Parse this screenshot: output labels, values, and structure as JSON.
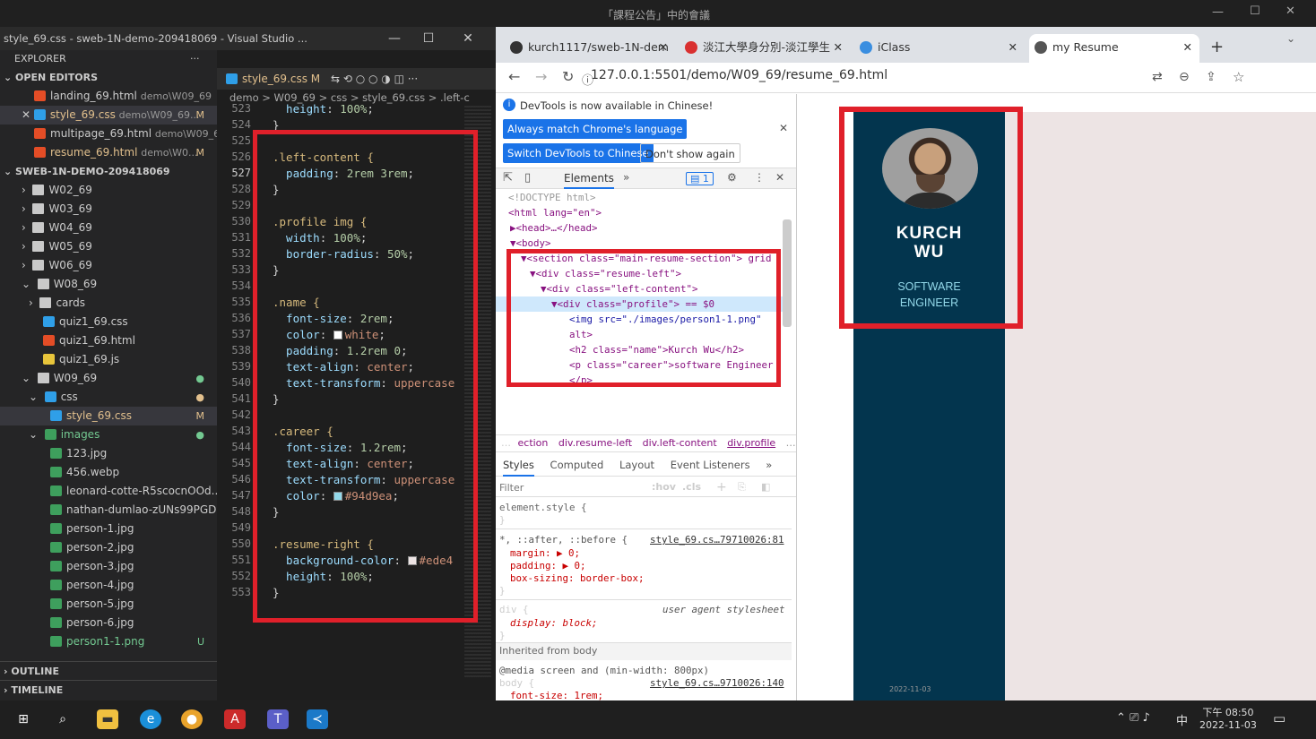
{
  "topbar": {
    "title": "「課程公告」中的會議"
  },
  "vscode": {
    "window_title": "style_69.css - sweb-1N-demo-209418069 - Visual Studio ...",
    "explorer_header": "EXPLORER",
    "open_editors_header": "OPEN EDITORS",
    "open_editors": [
      {
        "name": "landing_69.html",
        "path": "demo\\W09_69",
        "status": ""
      },
      {
        "name": "style_69.css",
        "path": "demo\\W09_69...",
        "status": "M"
      },
      {
        "name": "multipage_69.html",
        "path": "demo\\W09_69",
        "status": ""
      },
      {
        "name": "resume_69.html",
        "path": "demo\\W0...",
        "status": "M"
      }
    ],
    "workspace_header": "SWEB-1N-DEMO-209418069",
    "tree": [
      {
        "name": "W02_69"
      },
      {
        "name": "W03_69"
      },
      {
        "name": "W04_69"
      },
      {
        "name": "W05_69"
      },
      {
        "name": "W06_69"
      },
      {
        "name": "W08_69"
      },
      {
        "name": "cards"
      },
      {
        "name": "quiz1_69.css"
      },
      {
        "name": "quiz1_69.html"
      },
      {
        "name": "quiz1_69.js"
      },
      {
        "name": "W09_69"
      },
      {
        "name": "css"
      },
      {
        "name": "style_69.css",
        "status": "M"
      },
      {
        "name": "images"
      },
      {
        "name": "123.jpg"
      },
      {
        "name": "456.webp"
      },
      {
        "name": "leonard-cotte-R5scocnOOd..."
      },
      {
        "name": "nathan-dumlao-zUNs99PGD..."
      },
      {
        "name": "person-1.jpg"
      },
      {
        "name": "person-2.jpg"
      },
      {
        "name": "person-3.jpg"
      },
      {
        "name": "person-4.jpg"
      },
      {
        "name": "person-5.jpg"
      },
      {
        "name": "person-6.jpg"
      },
      {
        "name": "person1-1.png",
        "status": "U"
      }
    ],
    "outline": "OUTLINE",
    "timeline": "TIMELINE",
    "tab_label": "style_69.css M",
    "breadcrumb": "demo > W09_69 > css > style_69.css > .left-c",
    "code_lines": [
      {
        "n": "523",
        "t": "  height: 100%;"
      },
      {
        "n": "524",
        "t": "}"
      },
      {
        "n": "525",
        "t": ""
      },
      {
        "n": "526",
        "t": ".left-content {"
      },
      {
        "n": "527",
        "t": "  padding: 2rem 3rem;"
      },
      {
        "n": "528",
        "t": "}"
      },
      {
        "n": "529",
        "t": ""
      },
      {
        "n": "530",
        "t": ".profile img {"
      },
      {
        "n": "531",
        "t": "  width: 100%;"
      },
      {
        "n": "532",
        "t": "  border-radius: 50%;"
      },
      {
        "n": "533",
        "t": "}"
      },
      {
        "n": "534",
        "t": ""
      },
      {
        "n": "535",
        "t": ".name {"
      },
      {
        "n": "536",
        "t": "  font-size: 2rem;"
      },
      {
        "n": "537",
        "t": "  color: white;"
      },
      {
        "n": "538",
        "t": "  padding: 1.2rem 0;"
      },
      {
        "n": "539",
        "t": "  text-align: center;"
      },
      {
        "n": "540",
        "t": "  text-transform: uppercase"
      },
      {
        "n": "541",
        "t": "}"
      },
      {
        "n": "542",
        "t": ""
      },
      {
        "n": "543",
        "t": ".career {"
      },
      {
        "n": "544",
        "t": "  font-size: 1.2rem;"
      },
      {
        "n": "545",
        "t": "  text-align: center;"
      },
      {
        "n": "546",
        "t": "  text-transform: uppercase"
      },
      {
        "n": "547",
        "t": "  color: #94d9ea;"
      },
      {
        "n": "548",
        "t": "}"
      },
      {
        "n": "549",
        "t": ""
      },
      {
        "n": "550",
        "t": ".resume-right {"
      },
      {
        "n": "551",
        "t": "  background-color: #ede4"
      },
      {
        "n": "552",
        "t": "  height: 100%;"
      },
      {
        "n": "553",
        "t": "}"
      }
    ]
  },
  "chrome": {
    "tabs": [
      {
        "label": "kurch1117/sweb-1N-dem",
        "fav": "#333333"
      },
      {
        "label": "淡江大學身分別-淡江學生",
        "fav": "#d93030"
      },
      {
        "label": "iClass",
        "fav": "#3a8ee0"
      },
      {
        "label": "my Resume",
        "fav": "#555555"
      }
    ],
    "url": "127.0.0.1:5501/demo/W09_69/resume_69.html",
    "devtools": {
      "notice": "DevTools is now available in Chinese!",
      "btn_match": "Always match Chrome's language",
      "btn_switch": "Switch DevTools to Chinese",
      "btn_dont": "Don't show again",
      "elements_tab": "Elements",
      "issues_count": "1",
      "dom": [
        "<!DOCTYPE html>",
        "<html lang=\"en\">",
        "▶<head>…</head>",
        "▼<body>",
        "▼<section class=\"main-resume-section\"> grid",
        "▼<div class=\"resume-left\">",
        "▼<div class=\"left-content\">",
        "▼<div class=\"profile\"> == $0",
        "<img src=\"./images/person1-1.png\"",
        "alt>",
        "<h2 class=\"name\">Kurch Wu</h2>",
        "<p class=\"career\">software Engineer",
        "</p>"
      ],
      "path": [
        "…",
        "ection",
        "div.resume-left",
        "div.left-content",
        "div.profile",
        "…"
      ],
      "panes": [
        "Styles",
        "Computed",
        "Layout",
        "Event Listeners",
        "»"
      ],
      "filter_placeholder": "Filter",
      "hov": ":hov",
      "cls": ".cls",
      "rules": [
        "element.style {",
        "}",
        "*, ::after, ::before {",
        "style_69.cs…79710026:81",
        "margin: ▶ 0;",
        "padding: ▶ 0;",
        "box-sizing: border-box;",
        "}",
        "div {",
        "user agent stylesheet",
        "display: block;",
        "}",
        "Inherited from body",
        "@media screen and (min-width: 800px)",
        "body {",
        "style_69.cs…9710026:140",
        "font-size: 1rem;",
        "}"
      ]
    },
    "page": {
      "name_line1": "KURCH",
      "name_line2": "WU",
      "career_line1": "SOFTWARE",
      "career_line2": "ENGINEER",
      "date_hint": "2022-11-03"
    }
  },
  "taskbar": {
    "time": "下午 08:50",
    "date": "2022-11-03",
    "ime": "中"
  },
  "colors": {
    "highlight": "#e0202a",
    "profile_bg": "#03354e",
    "right_bg": "#ede4e4",
    "career": "#94d9ea"
  }
}
